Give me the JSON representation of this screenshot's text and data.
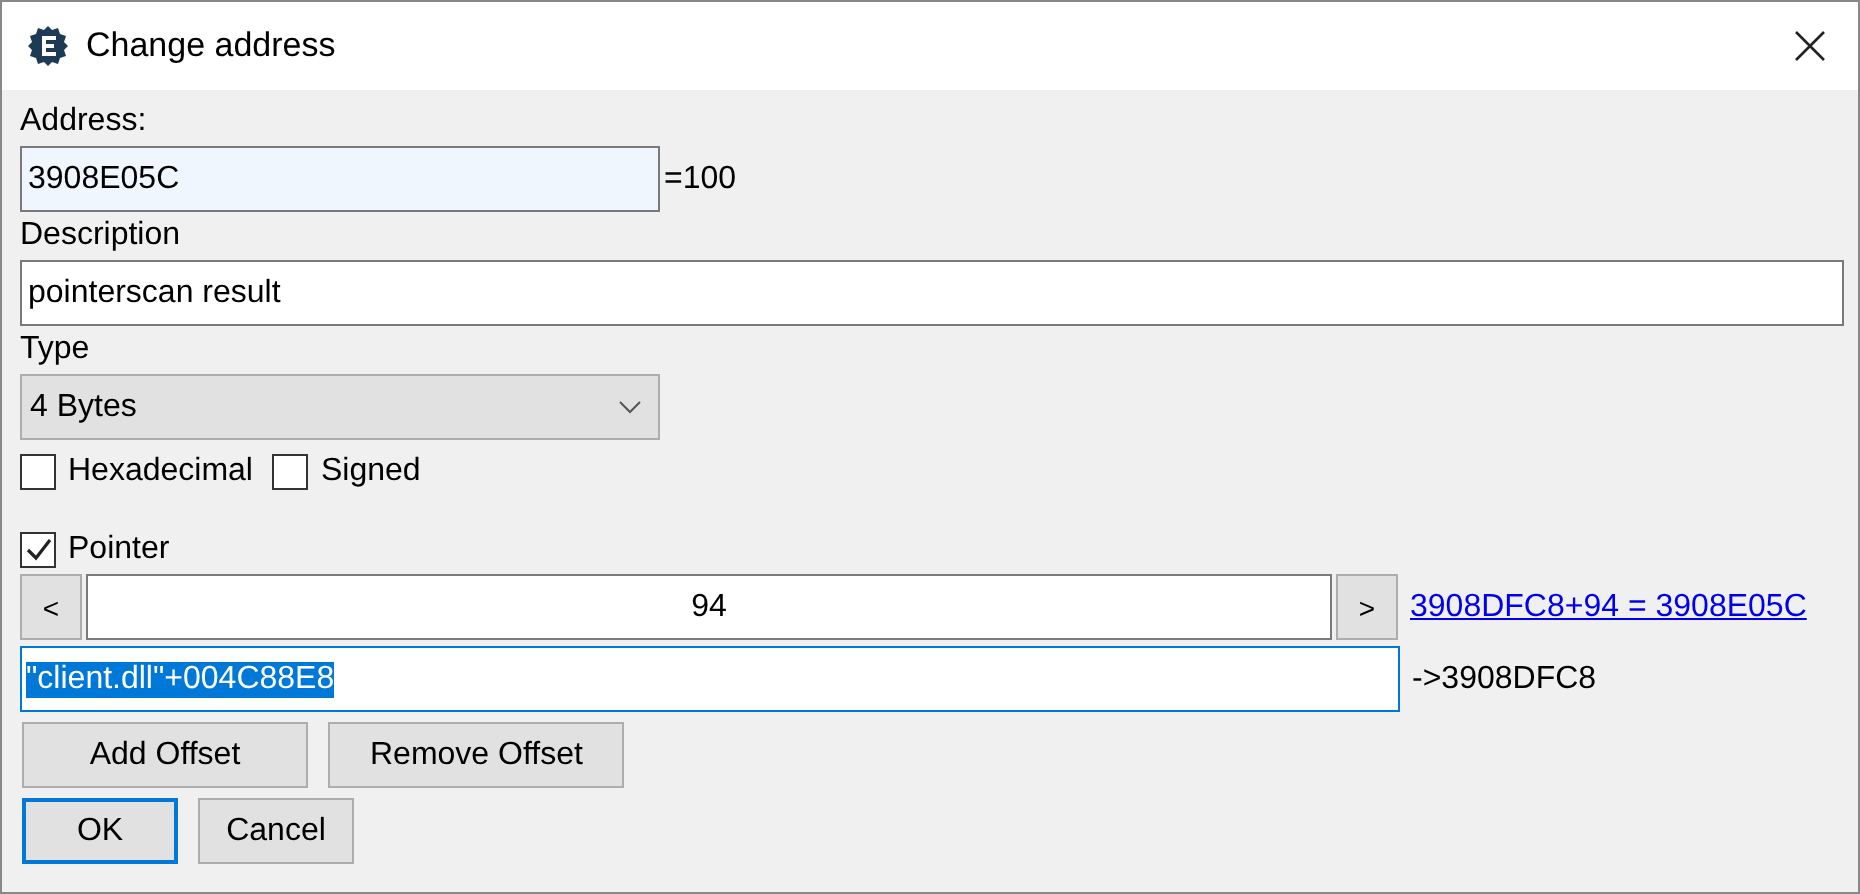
{
  "window": {
    "title": "Change address"
  },
  "address": {
    "label": "Address:",
    "value": "3908E05C",
    "result": "=100"
  },
  "description": {
    "label": "Description",
    "value": "pointerscan result"
  },
  "type": {
    "label": "Type",
    "value": "4 Bytes"
  },
  "options": [
    {
      "label": "Hexadecimal",
      "checked": false
    },
    {
      "label": "Signed",
      "checked": false
    }
  ],
  "pointer": {
    "label": "Pointer",
    "checked": true,
    "offsets": [
      {
        "prev": "<",
        "value": "94",
        "next": ">",
        "calculation": "3908DFC8+94 = 3908E05C"
      }
    ],
    "base": {
      "value": "\"client.dll\"+004C88E8",
      "text_selected": true,
      "result": "->3908DFC8"
    },
    "actions": [
      "Add Offset",
      "Remove Offset"
    ]
  },
  "buttons": [
    {
      "label": "OK",
      "default": true
    },
    {
      "label": "Cancel",
      "default": false
    }
  ]
}
